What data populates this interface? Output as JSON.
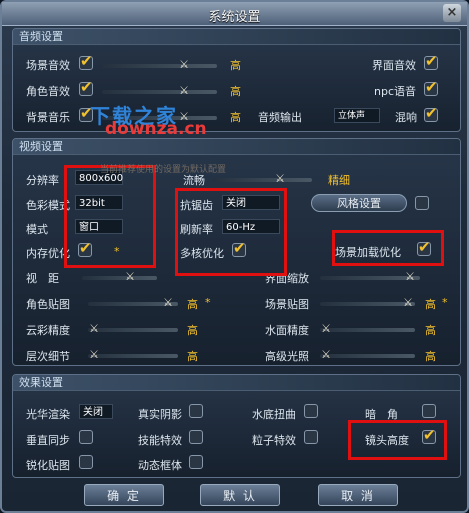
{
  "window": {
    "title": "系统设置",
    "close": "×"
  },
  "watermark": {
    "line1": "下载之家",
    "line2": "downza.cn",
    "faint": "当前推荐使用的设置为默认配置"
  },
  "audio": {
    "header": "音频设置",
    "scene_sfx": "场景音效",
    "ui_sfx": "界面音效",
    "char_sfx": "角色音效",
    "npc_voice": "npc语音",
    "bgm": "背景音乐",
    "audio_output": "音频输出",
    "output_value": "立体声",
    "reverb": "混响",
    "high": "高"
  },
  "video": {
    "header": "视频设置",
    "resolution": "分辨率",
    "resolution_value": "800x600",
    "color_mode": "色彩模式",
    "color_value": "32bit",
    "mode": "模式",
    "mode_value": "窗口",
    "memory_opt": "内存优化",
    "view_dist": "视　距",
    "fluency": "流畅",
    "fine": "精细",
    "antialias": "抗锯齿",
    "antialias_value": "关闭",
    "refresh": "刷新率",
    "refresh_value": "60-Hz",
    "multicore": "多核优化",
    "style_btn": "风格设置",
    "scene_load_opt": "场景加载优化",
    "ui_scale": "界面缩放",
    "char_tex": "角色贴图",
    "scene_tex": "场景贴图",
    "cloud": "云彩精度",
    "water": "水面精度",
    "lod": "层次细节",
    "hdr": "高级光照",
    "high": "高",
    "star": "*"
  },
  "effects": {
    "header": "效果设置",
    "bloom": "光华渲染",
    "bloom_value": "关闭",
    "shadow": "真实阴影",
    "water_distort": "水底扭曲",
    "dark_corner": "暗　角",
    "vsync": "垂直同步",
    "skill_fx": "技能特效",
    "particle": "粒子特效",
    "cam_height": "镜头高度",
    "sharpen": "锐化贴图",
    "dyn_frame": "动态框体"
  },
  "buttons": {
    "ok": "确 定",
    "default": "默 认",
    "cancel": "取 消"
  },
  "colors": {
    "accent": "#f2c12e",
    "highlight_box": "#e01010",
    "panel": "#1e2b3b"
  }
}
